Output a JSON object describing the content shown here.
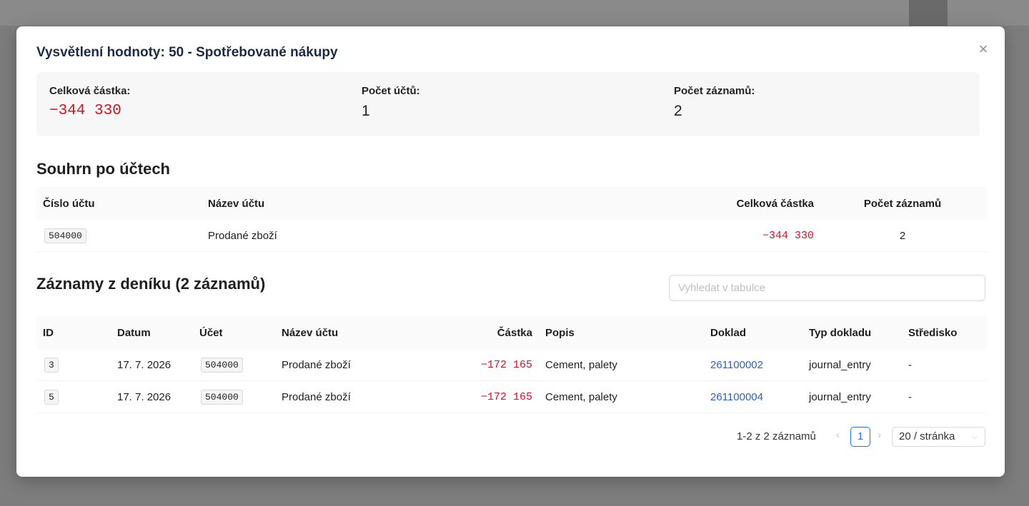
{
  "modal": {
    "title": "Vysvětlení hodnoty: 50 - Spotřebované nákupy",
    "close_icon": "close-icon"
  },
  "stats": {
    "total_label": "Celková částka:",
    "total_value": "−344 330",
    "accounts_label": "Počet účtů:",
    "accounts_value": "1",
    "records_label": "Počet záznamů:",
    "records_value": "2"
  },
  "summary": {
    "title": "Souhrn po účtech",
    "headers": {
      "account_number": "Číslo účtu",
      "account_name": "Název účtu",
      "total_amount": "Celková částka",
      "record_count": "Počet záznamů"
    },
    "rows": [
      {
        "account_number": "504000",
        "account_name": "Prodané zboží",
        "total_amount": "−344 330",
        "record_count": "2"
      }
    ]
  },
  "journal": {
    "title": "Záznamy z deníku (2 záznamů)",
    "search_placeholder": "Vyhledat v tabulce",
    "headers": {
      "id": "ID",
      "date": "Datum",
      "account": "Účet",
      "account_name": "Název účtu",
      "amount": "Částka",
      "description": "Popis",
      "document": "Doklad",
      "document_type": "Typ dokladu",
      "center": "Středisko"
    },
    "rows": [
      {
        "id": "3",
        "date": "17. 7. 2026",
        "account": "504000",
        "account_name": "Prodané zboží",
        "amount": "−172 165",
        "description": "Cement, palety",
        "document": "261100002",
        "document_type": "journal_entry",
        "center": "-"
      },
      {
        "id": "5",
        "date": "17. 7. 2026",
        "account": "504000",
        "account_name": "Prodané zboží",
        "amount": "−172 165",
        "description": "Cement, palety",
        "document": "261100004",
        "document_type": "journal_entry",
        "center": "-"
      }
    ]
  },
  "pagination": {
    "total_text": "1-2 z 2 záznamů",
    "prev_label": "‹",
    "next_label": "›",
    "current_page": "1",
    "page_size": "20 / stránka",
    "page_size_chevron": "⌵"
  },
  "colors": {
    "negative": "#cf1322",
    "link": "#2f62c0",
    "accent": "#1677ff"
  }
}
